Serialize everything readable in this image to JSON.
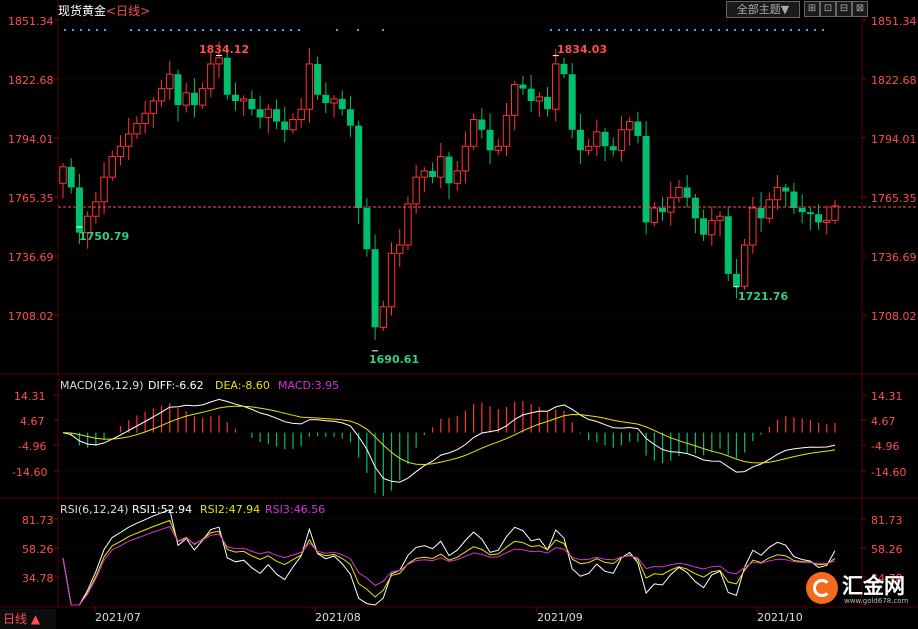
{
  "header": {
    "instrument": "现货黄金",
    "period_label": "<日线>",
    "theme_button": "全部主题▼",
    "window_buttons": [
      "⊞",
      "⊡",
      "⊟",
      "⊠"
    ]
  },
  "price_axis": {
    "ticks": [
      "1851.34",
      "1822.68",
      "1794.01",
      "1765.35",
      "1736.69",
      "1708.02"
    ],
    "current_line": 1760.5
  },
  "annotations": {
    "high1": "1834.12",
    "low1": "1750.79",
    "high2": "1834.03",
    "low2": "1690.61",
    "low3": "1721.76"
  },
  "macd": {
    "label": "MACD(26,12,9)",
    "diff": "DIFF:-6.62",
    "dea": "DEA:-8.60",
    "macd": "MACD:3.95",
    "ticks": [
      "14.31",
      "4.67",
      "-4.96",
      "-14.60"
    ]
  },
  "rsi": {
    "label": "RSI(6,12,24)",
    "rsi1": "RSI1:52.94",
    "rsi2": "RSI2:47.94",
    "rsi3": "RSI3:46.56",
    "ticks": [
      "81.73",
      "58.26",
      "34.78"
    ]
  },
  "x_axis": {
    "labels": [
      "2021/07",
      "2021/08",
      "2021/09",
      "2021/10"
    ]
  },
  "period_tab": "日线 ▲",
  "logo": {
    "text": "汇金网",
    "url": "www.gold678.com"
  },
  "colors": {
    "up": "#ff3333",
    "down": "#00c070",
    "grid": "#5a0000",
    "axis_text": "#ff4d4d",
    "rsi1": "#ffffff",
    "rsi2": "#e6e600",
    "rsi3": "#d633d6"
  },
  "chart_data": {
    "type": "candlestick",
    "series_close": [
      1780,
      1770,
      1748,
      1756,
      1763,
      1775,
      1785,
      1790,
      1796,
      1801,
      1806,
      1812,
      1818,
      1825,
      1810,
      1816,
      1810,
      1818,
      1830,
      1833,
      1815,
      1812,
      1813,
      1808,
      1804,
      1808,
      1802,
      1798,
      1803,
      1808,
      1830,
      1815,
      1811,
      1813,
      1808,
      1800,
      1760,
      1740,
      1702,
      1712,
      1738,
      1742,
      1762,
      1775,
      1778,
      1775,
      1785,
      1772,
      1778,
      1790,
      1803,
      1798,
      1788,
      1790,
      1805,
      1820,
      1818,
      1812,
      1814,
      1808,
      1830,
      1825,
      1798,
      1788,
      1790,
      1797,
      1790,
      1788,
      1798,
      1802,
      1795,
      1753,
      1760,
      1758,
      1765,
      1770,
      1765,
      1755,
      1747,
      1754,
      1756,
      1728,
      1722,
      1742,
      1760,
      1755,
      1764,
      1770,
      1768,
      1760,
      1758,
      1757,
      1753,
      1754,
      1761
    ]
  }
}
